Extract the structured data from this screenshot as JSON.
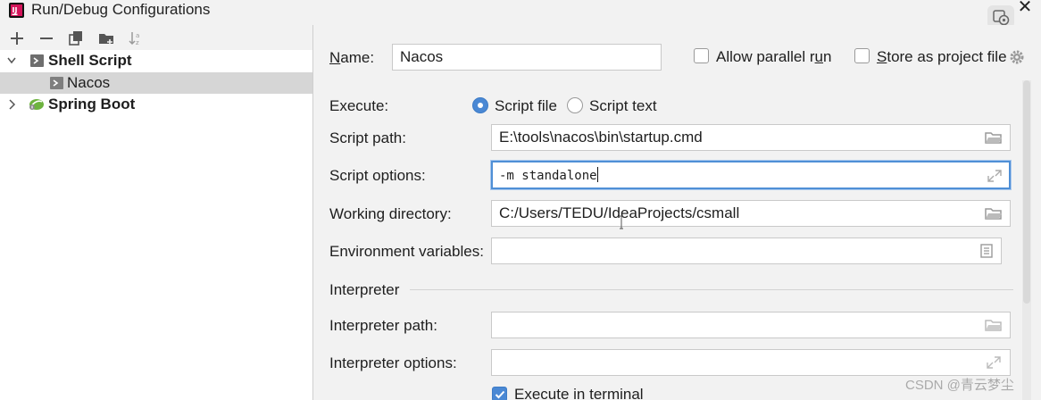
{
  "window": {
    "title": "Run/Debug Configurations",
    "close_label": "✕"
  },
  "tree": {
    "items": [
      {
        "label": "Shell Script",
        "expanded": true,
        "icon": "shell-script-icon"
      },
      {
        "label": "Nacos",
        "selected": true,
        "icon": "shell-script-icon"
      },
      {
        "label": "Spring Boot",
        "expanded": false,
        "icon": "spring-boot-icon"
      }
    ]
  },
  "toolbar": {
    "add": "add-icon",
    "remove": "remove-icon",
    "copy": "copy-icon",
    "folder": "new-folder-icon",
    "sort": "sort-icon"
  },
  "form": {
    "name_label_u": "N",
    "name_label_rest": "ame:",
    "name_value": "Nacos",
    "allow_parallel_label_pre": "Allow parallel r",
    "allow_parallel_label_u": "u",
    "allow_parallel_label_post": "n",
    "store_project_label_u": "S",
    "store_project_label_rest": "tore as project file",
    "execute_label": "Execute:",
    "script_file_label": "Script file",
    "script_text_label": "Script text",
    "execute_mode": "Script file",
    "script_path_label": "Script path:",
    "script_path_value": "E:\\tools\\nacos\\bin\\startup.cmd",
    "script_options_label": "Script options:",
    "script_options_value": "-m standalone",
    "working_dir_label": "Working directory:",
    "working_dir_value": "C:/Users/TEDU/IdeaProjects/csmall",
    "env_vars_label": "Environment variables:",
    "env_vars_value": "",
    "interpreter_section": "Interpreter",
    "interpreter_path_label": "Interpreter path:",
    "interpreter_path_value": "",
    "interpreter_options_label": "Interpreter options:",
    "interpreter_options_value": "",
    "execute_terminal_label": "Execute in terminal",
    "execute_terminal_checked": true,
    "allow_parallel_checked": false,
    "store_project_checked": false
  },
  "colors": {
    "accent": "#4a88d4",
    "focus_border": "#4f8fd6",
    "selection": "#d6d6d6",
    "spring_green": "#6db33f"
  },
  "watermark": "CSDN @青云梦尘"
}
